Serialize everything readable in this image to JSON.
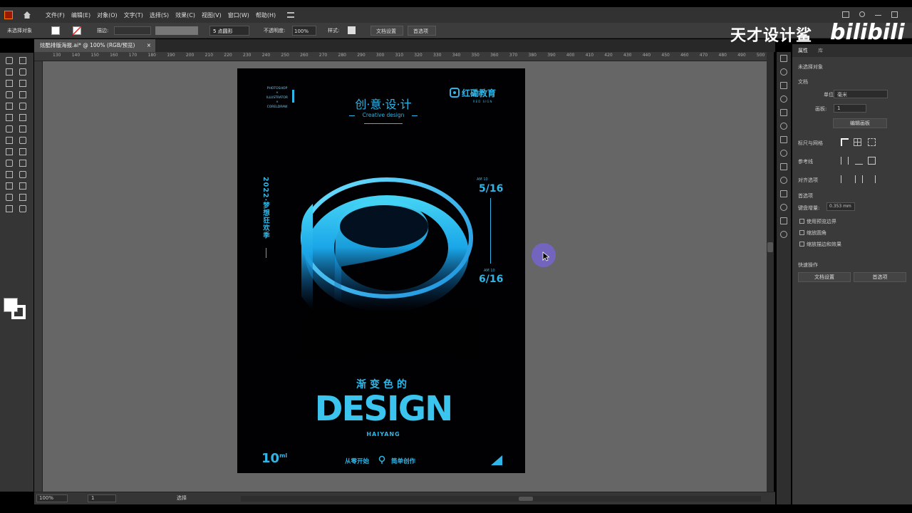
{
  "menubar": {
    "items": [
      "文件(F)",
      "编辑(E)",
      "对象(O)",
      "文字(T)",
      "选择(S)",
      "效果(C)",
      "视图(V)",
      "窗口(W)",
      "帮助(H)"
    ]
  },
  "controlbar": {
    "selection": "未选择对象",
    "stroke_label": "描边:",
    "brush_label": "5 点圆形",
    "opacity_label": "不透明度:",
    "opacity_value": "100%",
    "style_label": "样式:",
    "doc_settings": "文档设置",
    "prefs": "首选项"
  },
  "tab": {
    "title": "炫酷排版海报.ai* @ 100% (RGB/预览)",
    "close": "×"
  },
  "ruler": {
    "ticks": [
      "130",
      "140",
      "150",
      "160",
      "170",
      "180",
      "190",
      "200",
      "210",
      "220",
      "230",
      "240",
      "250",
      "260",
      "270",
      "280",
      "290",
      "300",
      "310",
      "320",
      "330",
      "340",
      "350",
      "360",
      "370",
      "380",
      "390",
      "400",
      "410",
      "420",
      "430",
      "440",
      "450",
      "460",
      "470",
      "480",
      "490",
      "500",
      "510"
    ]
  },
  "status": {
    "zoom": "100%",
    "artboard": "1",
    "tool": "选择"
  },
  "watermark": {
    "text": "天才设计鲨",
    "logo": "bilibili"
  },
  "props": {
    "tab_properties": "属性",
    "tab_other": "库",
    "no_selection": "未选择对象",
    "document": "文档",
    "units_label": "单位:",
    "units_value": "毫米",
    "artboard_label": "画板:",
    "artboard_value": "1",
    "edit_artboard": "编辑画板",
    "rulers_grids": "标尺与网格",
    "guides": "参考线",
    "align": "对齐选项",
    "prefs_section": "首选项",
    "keyboard_inc": "键盘增量:",
    "keyboard_value": "0.353 mm",
    "cb_preview": "使用预览边界",
    "cb_corners": "缩放圆角",
    "cb_strokes": "缩放描边和效果",
    "quick_actions": "快速操作",
    "btn_doc_settings": "文档设置",
    "btn_prefs": "首选项"
  },
  "poster": {
    "sw_lines": [
      "PHOTOSHOP",
      "×",
      "ILLUSTRATOR",
      "×",
      "CORELDRAW"
    ],
    "title": "创·意·设·计",
    "subtitle": "Creative design",
    "brand": "红磡教育",
    "brand_sub": "RED SIGN",
    "vertical": "2022·梦想狂欢季",
    "date1_time": "AM 10",
    "date1": "5/16",
    "date2_time": "AM 10",
    "date2": "6/16",
    "headline": "渐变色的",
    "design": "DESIGN",
    "haiyang": "HAIYANG",
    "volume": "10",
    "volume_unit": "ml",
    "footer1": "从零开始",
    "footer2": "简单创作"
  },
  "colors": {
    "accent": "#2fb6e6",
    "canvas": "#666666",
    "panel": "#3a3a3a"
  }
}
